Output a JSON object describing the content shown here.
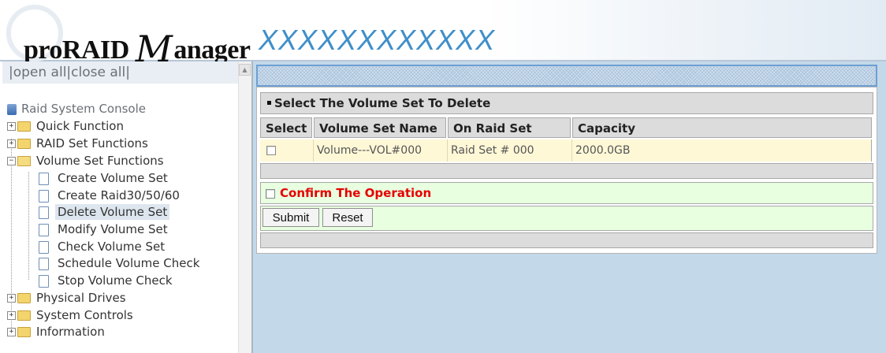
{
  "header": {
    "brand_prefix": "proRAID",
    "brand_script": "M",
    "brand_suffix": "anager",
    "model": "XXXXXXXXXXXX"
  },
  "sidebar": {
    "open_close": "|open all|close all|",
    "root": "Raid System Console",
    "items": [
      {
        "label": "Quick Function",
        "type": "folder",
        "expanded": false
      },
      {
        "label": "RAID Set Functions",
        "type": "folder",
        "expanded": false
      },
      {
        "label": "Volume Set Functions",
        "type": "folder",
        "expanded": true
      },
      {
        "label": "Create Volume Set",
        "type": "page"
      },
      {
        "label": "Create Raid30/50/60",
        "type": "page"
      },
      {
        "label": "Delete Volume Set",
        "type": "page",
        "selected": true
      },
      {
        "label": "Modify Volume Set",
        "type": "page"
      },
      {
        "label": "Check Volume Set",
        "type": "page"
      },
      {
        "label": "Schedule Volume Check",
        "type": "page"
      },
      {
        "label": "Stop Volume Check",
        "type": "page"
      },
      {
        "label": "Physical Drives",
        "type": "folder",
        "expanded": false
      },
      {
        "label": "System Controls",
        "type": "folder",
        "expanded": false
      },
      {
        "label": "Information",
        "type": "folder",
        "expanded": false
      }
    ]
  },
  "main": {
    "section_title": "Select The Volume Set To Delete",
    "columns": [
      "Select",
      "Volume Set Name",
      "On Raid Set",
      "Capacity"
    ],
    "rows": [
      {
        "selected": false,
        "name": "Volume---VOL#000",
        "raid_set": "Raid Set # 000",
        "capacity": "2000.0GB"
      }
    ],
    "confirm_label": "Confirm The Operation",
    "submit_label": "Submit",
    "reset_label": "Reset"
  },
  "colors": {
    "model_text": "#3f8fc9",
    "confirm_text": "#e60000",
    "row_bg": "#fff8d7",
    "confirm_bg": "#e8ffe0",
    "main_bg": "#c3d9ea"
  }
}
